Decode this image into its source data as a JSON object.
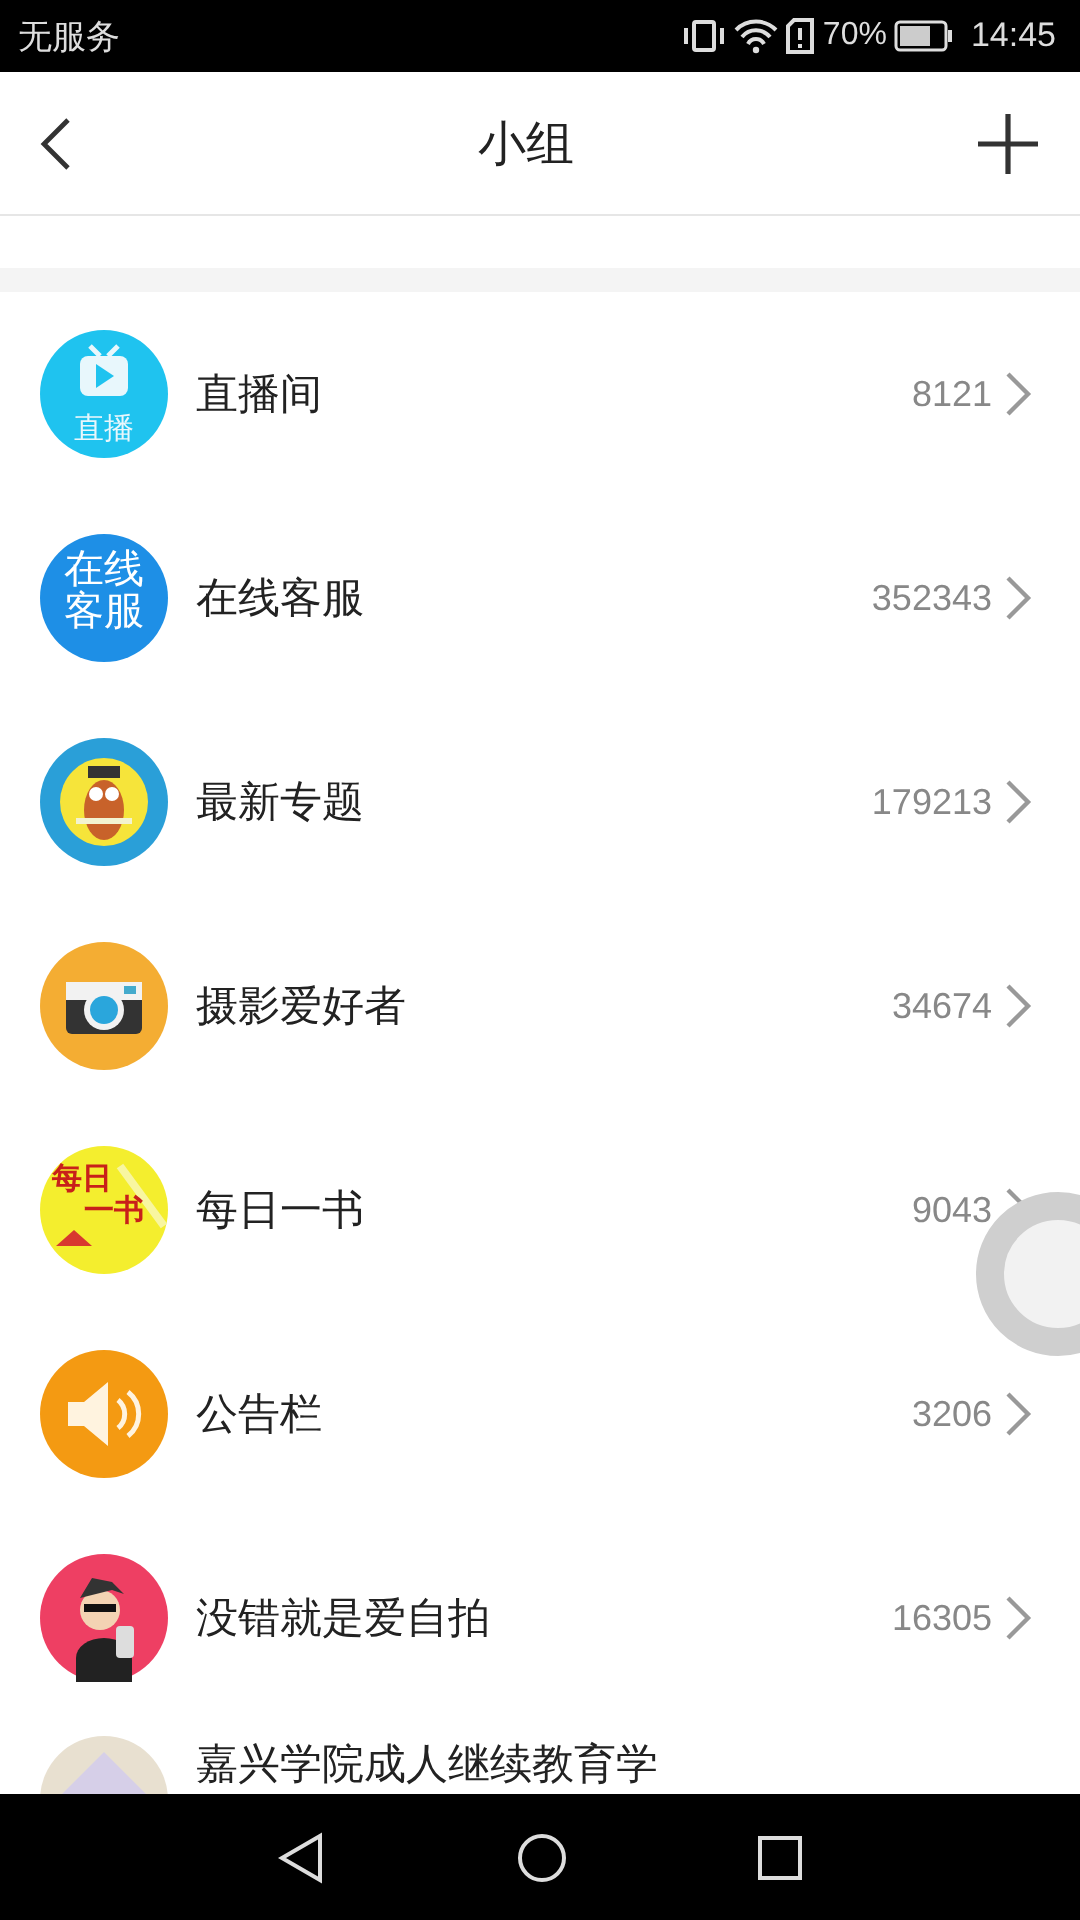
{
  "status_bar": {
    "carrier": "无服务",
    "battery_text": "70%",
    "time": "14:45"
  },
  "header": {
    "title": "小组"
  },
  "groups": [
    {
      "name": "直播间",
      "count": "8121",
      "kind": "tv",
      "icon_text": [
        "直播"
      ]
    },
    {
      "name": "在线客服",
      "count": "352343",
      "kind": "text",
      "icon_text": [
        "在线",
        "客服"
      ]
    },
    {
      "name": "最新专题",
      "count": "179213",
      "kind": "owl"
    },
    {
      "name": "摄影爱好者",
      "count": "34674",
      "kind": "camera"
    },
    {
      "name": "每日一书",
      "count": "9043",
      "kind": "book",
      "icon_text": [
        "每日",
        "一书"
      ]
    },
    {
      "name": "公告栏",
      "count": "3206",
      "kind": "speaker"
    },
    {
      "name": "没错就是爱自拍",
      "count": "16305",
      "kind": "person"
    },
    {
      "name": "嘉兴学院成人继续教育学",
      "kind": "photo"
    }
  ]
}
